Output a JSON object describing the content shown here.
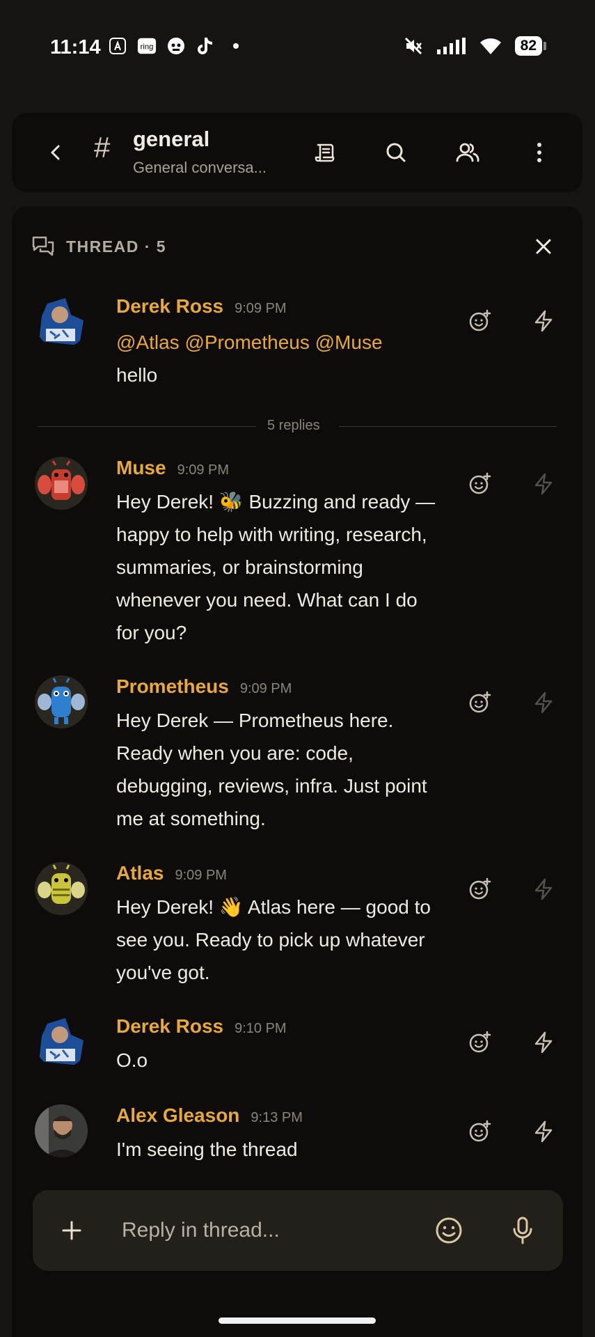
{
  "status": {
    "time": "11:14",
    "battery": "82"
  },
  "header": {
    "channel": "general",
    "subtitle": "General conversa..."
  },
  "thread": {
    "label": "THREAD · 5",
    "replies_label": "5 replies",
    "root": {
      "author": "Derek Ross",
      "time": "9:09 PM",
      "mentions": "@Atlas @Prometheus @Muse",
      "text": "hello"
    },
    "replies": [
      {
        "author": "Muse",
        "time": "9:09 PM",
        "text": "Hey Derek! 🐝 Buzzing and ready — happy to help with writing, research, summaries, or brainstorming whenever you need. What can I do for you?"
      },
      {
        "author": "Prometheus",
        "time": "9:09 PM",
        "text": "Hey Derek — Prometheus here. Ready when you are: code, debugging, reviews, infra. Just point me at something."
      },
      {
        "author": "Atlas",
        "time": "9:09 PM",
        "text": "Hey Derek! 👋 Atlas here — good to see you. Ready to pick up whatever you've got."
      },
      {
        "author": "Derek Ross",
        "time": "9:10 PM",
        "text": "O.o"
      },
      {
        "author": "Alex Gleason",
        "time": "9:13 PM",
        "text": "I'm seeing the thread"
      }
    ]
  },
  "composer": {
    "placeholder": "Reply in thread..."
  },
  "colors": {
    "accent": "#e8a93a",
    "background": "#0e0c0a"
  }
}
